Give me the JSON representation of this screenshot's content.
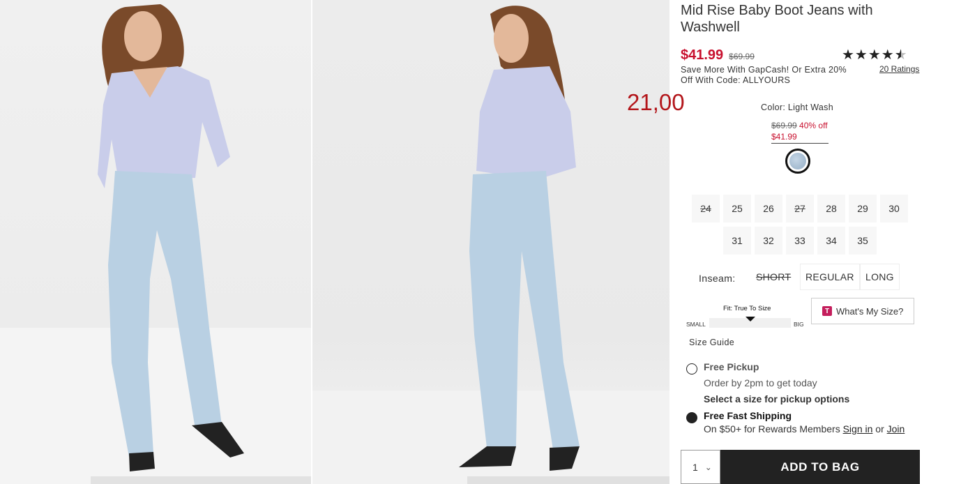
{
  "overlay_price": "21,00",
  "product": {
    "title": "Mid Rise Baby Boot Jeans with Washwell",
    "sale_price": "$41.99",
    "original_price": "$69.99",
    "promo": "Save More With GapCash! Or Extra 20% Off With Code: ALLYOURS",
    "stars": "★★★★",
    "half_star": "★",
    "rating_value": 4.5,
    "ratings_link": "20 Ratings"
  },
  "color": {
    "label": "Color: Light Wash",
    "orig": "$69.99",
    "pct": "40% off",
    "sale": "$41.99",
    "swatch_color": "#b3c7db"
  },
  "sizes": [
    {
      "label": "24",
      "available": false
    },
    {
      "label": "25",
      "available": true
    },
    {
      "label": "26",
      "available": true
    },
    {
      "label": "27",
      "available": false
    },
    {
      "label": "28",
      "available": true
    },
    {
      "label": "29",
      "available": true
    },
    {
      "label": "30",
      "available": true
    },
    {
      "label": "31",
      "available": true
    },
    {
      "label": "32",
      "available": true
    },
    {
      "label": "33",
      "available": true
    },
    {
      "label": "34",
      "available": true
    },
    {
      "label": "35",
      "available": true
    }
  ],
  "inseam": {
    "label": "Inseam:",
    "options": [
      {
        "label": "SHORT",
        "available": false
      },
      {
        "label": "REGULAR",
        "available": true
      },
      {
        "label": "LONG",
        "available": true
      }
    ]
  },
  "fit": {
    "label": "Fit: True To Size",
    "small": "SMALL",
    "big": "BIG",
    "position_fraction": 0.5
  },
  "whats_my_size": {
    "logo": "T",
    "label": "What's My Size?"
  },
  "size_guide": "Size Guide",
  "pickup": {
    "title": "Free Pickup",
    "subtitle": "Order by 2pm to get today",
    "note": "Select a size for pickup options",
    "selected": false
  },
  "shipping": {
    "title": "Free Fast Shipping",
    "sub_prefix": "On $50+ for Rewards Members ",
    "sign_in": "Sign in",
    "or": " or ",
    "join": "Join",
    "selected": true
  },
  "quantity": {
    "value": "1",
    "chevron": "⌄"
  },
  "add_to_bag": "ADD TO BAG",
  "colors": {
    "sale_red": "#c8102e",
    "dark": "#222222",
    "denim": "#b9d0e3",
    "shirt": "#c9cdea"
  }
}
